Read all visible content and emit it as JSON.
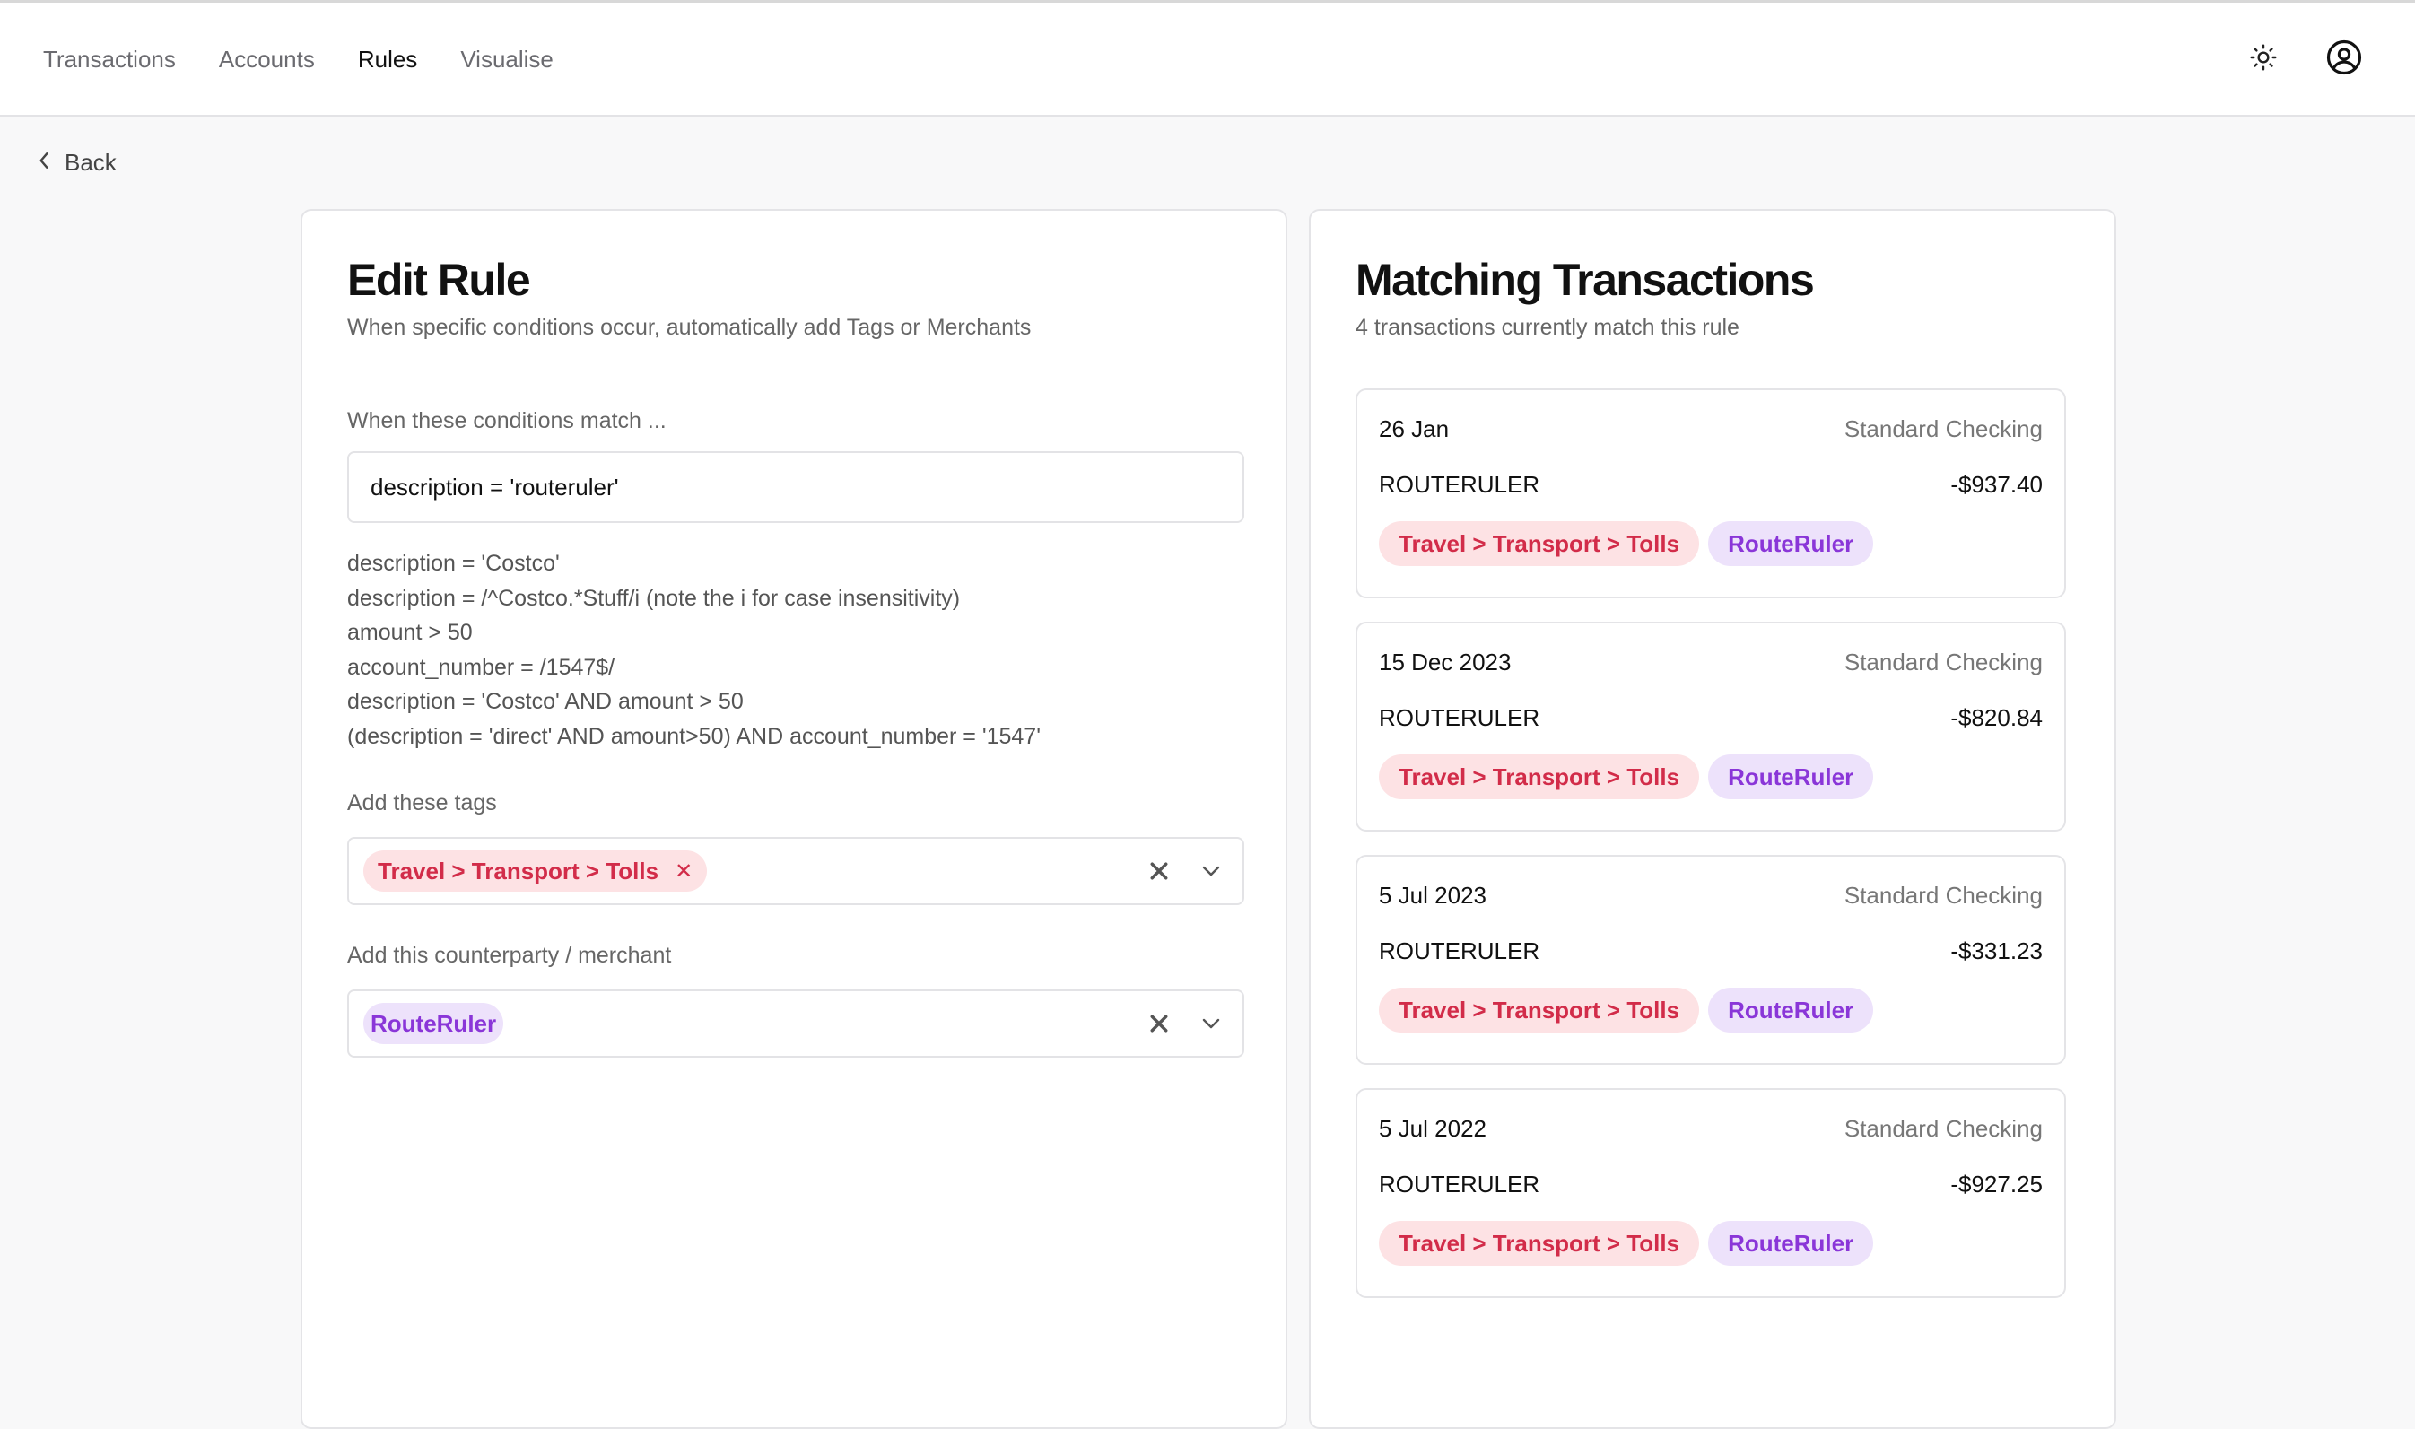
{
  "nav": {
    "items": [
      {
        "label": "Transactions"
      },
      {
        "label": "Accounts"
      },
      {
        "label": "Rules"
      },
      {
        "label": "Visualise"
      }
    ],
    "active": "Rules"
  },
  "header_icons": [
    "sun-icon",
    "user-circle-icon"
  ],
  "back": {
    "label": "Back"
  },
  "edit_rule": {
    "title": "Edit Rule",
    "subtitle": "When specific conditions occur, automatically add Tags or Merchants",
    "conditions_label": "When these conditions match ...",
    "conditions_value": "description = 'routeruler'",
    "examples": [
      "description = 'Costco'",
      "description = /^Costco.*Stuff/i (note the i for case insensitivity)",
      "amount > 50",
      "account_number = /1547$/",
      "description = 'Costco' AND amount > 50",
      "(description = 'direct' AND amount>50) AND account_number = '1547'"
    ],
    "tags_label": "Add these tags",
    "tags_selected": [
      "Travel > Transport > Tolls"
    ],
    "merchant_label": "Add this counterparty / merchant",
    "merchant_selected": "RouteRuler"
  },
  "matching": {
    "title": "Matching Transactions",
    "subtitle": "4 transactions currently match this rule",
    "transactions": [
      {
        "date": "26 Jan",
        "account": "Standard Checking",
        "description": "ROUTERULER",
        "amount": "-$937.40",
        "tag": "Travel > Transport > Tolls",
        "merchant": "RouteRuler"
      },
      {
        "date": "15 Dec 2023",
        "account": "Standard Checking",
        "description": "ROUTERULER",
        "amount": "-$820.84",
        "tag": "Travel > Transport > Tolls",
        "merchant": "RouteRuler"
      },
      {
        "date": "5 Jul 2023",
        "account": "Standard Checking",
        "description": "ROUTERULER",
        "amount": "-$331.23",
        "tag": "Travel > Transport > Tolls",
        "merchant": "RouteRuler"
      },
      {
        "date": "5 Jul 2022",
        "account": "Standard Checking",
        "description": "ROUTERULER",
        "amount": "-$927.25",
        "tag": "Travel > Transport > Tolls",
        "merchant": "RouteRuler"
      }
    ]
  },
  "colors": {
    "tag_bg": "#fde2e4",
    "tag_text": "#d22c49",
    "merchant_bg": "#ede2fb",
    "merchant_text": "#8a36d8",
    "page_bg": "#f8f8f9"
  }
}
